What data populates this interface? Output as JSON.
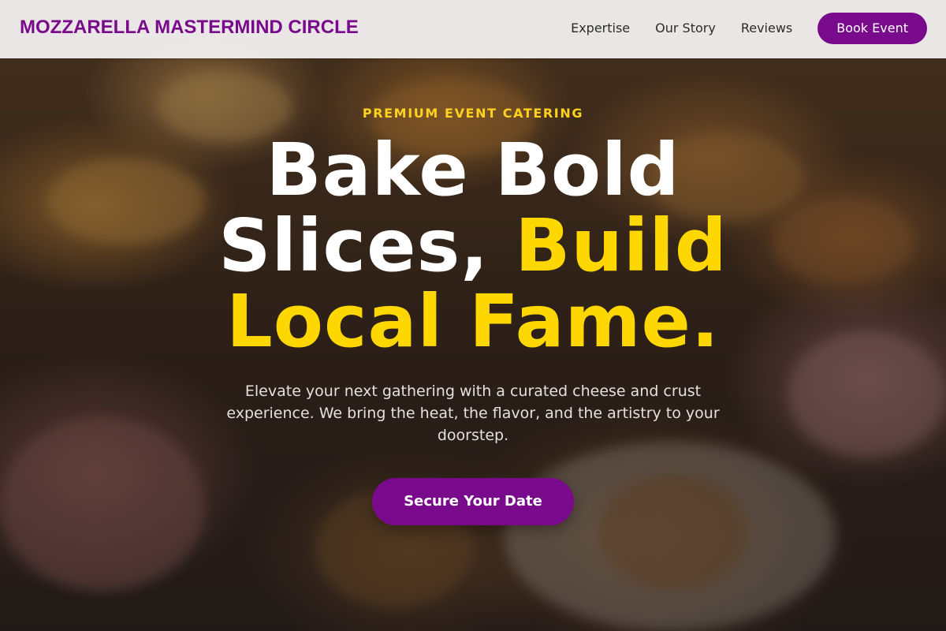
{
  "nav": {
    "brand": "MOZZARELLA MASTERMIND CIRCLE",
    "links": [
      {
        "label": "Expertise"
      },
      {
        "label": "Our Story"
      },
      {
        "label": "Reviews"
      }
    ],
    "cta_label": "Book Event"
  },
  "hero": {
    "eyebrow": "PREMIUM EVENT CATERING",
    "headline_part1": "Bake Bold Slices, ",
    "headline_accent": "Build Local Fame.",
    "subtitle": "Elevate your next gathering with a curated cheese and crust experience. We bring the heat, the flavor, and the artistry to your doorstep.",
    "cta_label": "Secure Your Date"
  },
  "colors": {
    "brand": "#7a0a8c",
    "accent": "#ffd700",
    "eyebrow": "#ffd21f",
    "nav_background": "#f4f2f3"
  }
}
